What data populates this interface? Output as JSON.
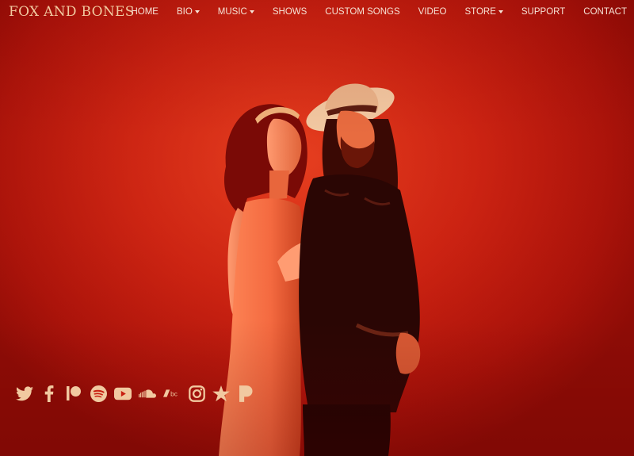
{
  "site": {
    "brand": "FOX AND BONES",
    "accent_color": "#f1c9a0",
    "background_color": "#c81e10"
  },
  "nav": {
    "items": [
      {
        "label": "HOME",
        "dropdown": false
      },
      {
        "label": "BIO",
        "dropdown": true
      },
      {
        "label": "MUSIC",
        "dropdown": true
      },
      {
        "label": "SHOWS",
        "dropdown": false
      },
      {
        "label": "CUSTOM SONGS",
        "dropdown": false
      },
      {
        "label": "VIDEO",
        "dropdown": false
      },
      {
        "label": "STORE",
        "dropdown": true
      },
      {
        "label": "SUPPORT",
        "dropdown": false
      },
      {
        "label": "CONTACT",
        "dropdown": false
      }
    ]
  },
  "hero": {
    "image": "band-portrait-red"
  },
  "social": {
    "icons": [
      "twitter-icon",
      "facebook-icon",
      "patreon-icon",
      "spotify-icon",
      "youtube-icon",
      "soundcloud-icon",
      "bandcamp-icon",
      "instagram-icon",
      "star-icon",
      "pandora-icon"
    ]
  }
}
